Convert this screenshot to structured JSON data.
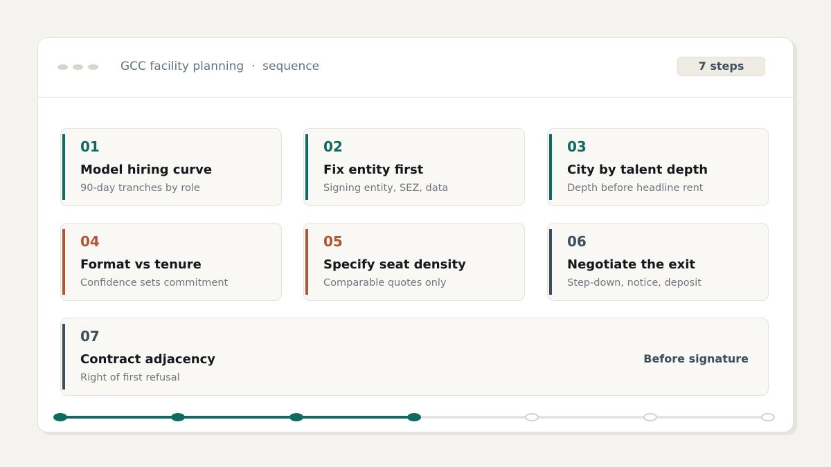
{
  "window": {
    "title": "GCC facility planning  ·  sequence",
    "badge": "7 steps"
  },
  "steps": [
    {
      "num": "01",
      "title": "Model hiring curve",
      "subtitle": "90-day tranches by role",
      "accent": "#0e6b60"
    },
    {
      "num": "02",
      "title": "Fix entity first",
      "subtitle": "Signing entity, SEZ, data",
      "accent": "#0e6b60"
    },
    {
      "num": "03",
      "title": "City by talent depth",
      "subtitle": "Depth before headline rent",
      "accent": "#0e6b60"
    },
    {
      "num": "04",
      "title": "Format vs tenure",
      "subtitle": "Confidence sets commitment",
      "accent": "#b15634"
    },
    {
      "num": "05",
      "title": "Specify seat density",
      "subtitle": "Comparable quotes only",
      "accent": "#b15634"
    },
    {
      "num": "06",
      "title": "Negotiate the exit",
      "subtitle": "Step-down, notice, deposit",
      "accent": "#3b4f5e"
    },
    {
      "num": "07",
      "title": "Contract adjacency",
      "subtitle": "Right of first refusal",
      "note": "Before signature",
      "accent": "#3b4f5e"
    }
  ],
  "progress": {
    "total_steps": 7,
    "completed_steps": 4,
    "colors": {
      "done": "#0e6b60",
      "todo": "#d4d1ca"
    }
  }
}
